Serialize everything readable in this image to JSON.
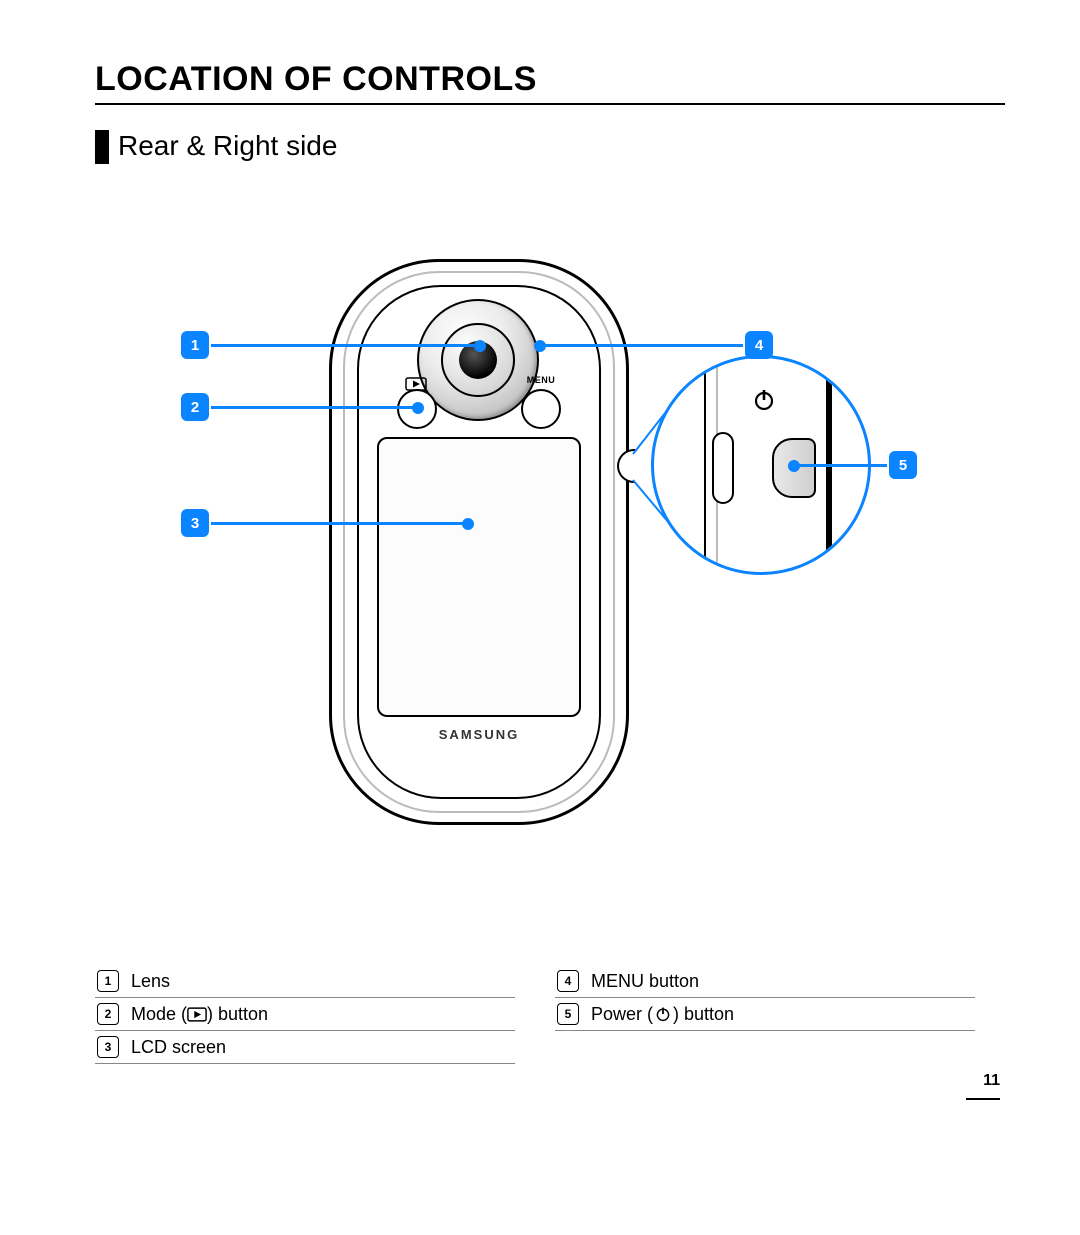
{
  "title": "LOCATION OF CONTROLS",
  "subtitle": "Rear & Right side",
  "page_number": "11",
  "brand": "SAMSUNG",
  "labels": {
    "menu": "MENU"
  },
  "callouts": {
    "c1": "1",
    "c2": "2",
    "c3": "3",
    "c4": "4",
    "c5": "5"
  },
  "legend": {
    "left": [
      {
        "num": "1",
        "text": "Lens"
      },
      {
        "num": "2",
        "text_pre": "Mode (",
        "text_post": ") button",
        "icon": "play-rect"
      },
      {
        "num": "3",
        "text": "LCD screen"
      }
    ],
    "right": [
      {
        "num": "4",
        "text": "MENU button"
      },
      {
        "num": "5",
        "text_pre": "Power (",
        "text_post": ") button",
        "icon": "power"
      }
    ]
  }
}
